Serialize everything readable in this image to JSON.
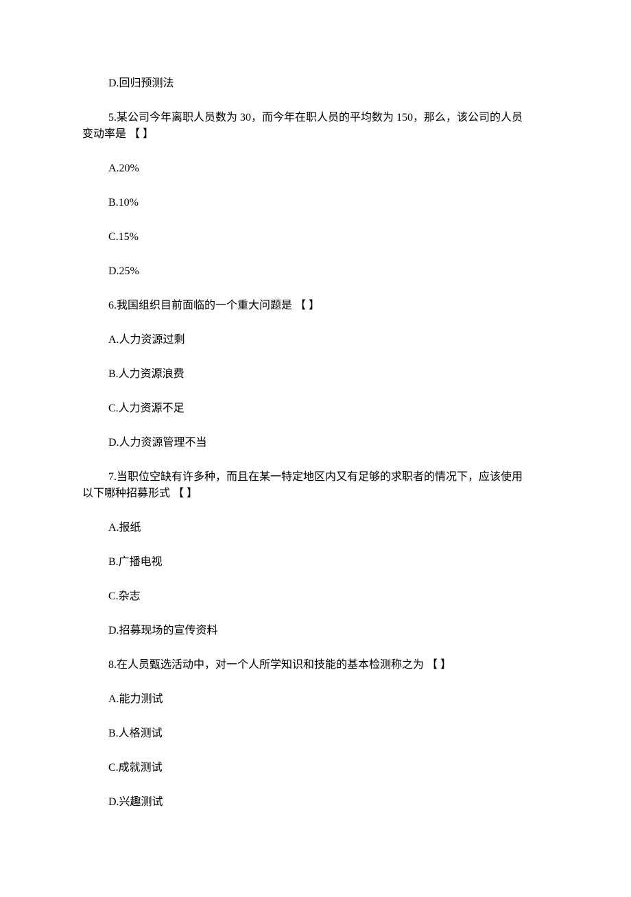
{
  "orphan_option": "D.回归预测法",
  "questions": [
    {
      "stem_line1": "5.某公司今年离职人员数为 30，而今年在职人员的平均数为 150，那么，该公司的人员",
      "stem_line2": "变动率是 【 】",
      "options": [
        "A.20%",
        "B.10%",
        "C.15%",
        "D.25%"
      ]
    },
    {
      "stem_line1": "6.我国组织目前面临的一个重大问题是 【 】",
      "options": [
        "A.人力资源过剩",
        "B.人力资源浪费",
        "C.人力资源不足",
        "D.人力资源管理不当"
      ]
    },
    {
      "stem_line1": "7.当职位空缺有许多种，而且在某一特定地区内又有足够的求职者的情况下，应该使用",
      "stem_line2": "以下哪种招募形式 【 】",
      "options": [
        "A.报纸",
        "B.广播电视",
        "C.杂志",
        "D.招募现场的宣传资料"
      ]
    },
    {
      "stem_line1": "8.在人员甄选活动中，对一个人所学知识和技能的基本检测称之为 【 】",
      "options": [
        "A.能力测试",
        "B.人格测试",
        "C.成就测试",
        "D.兴趣测试"
      ]
    }
  ]
}
